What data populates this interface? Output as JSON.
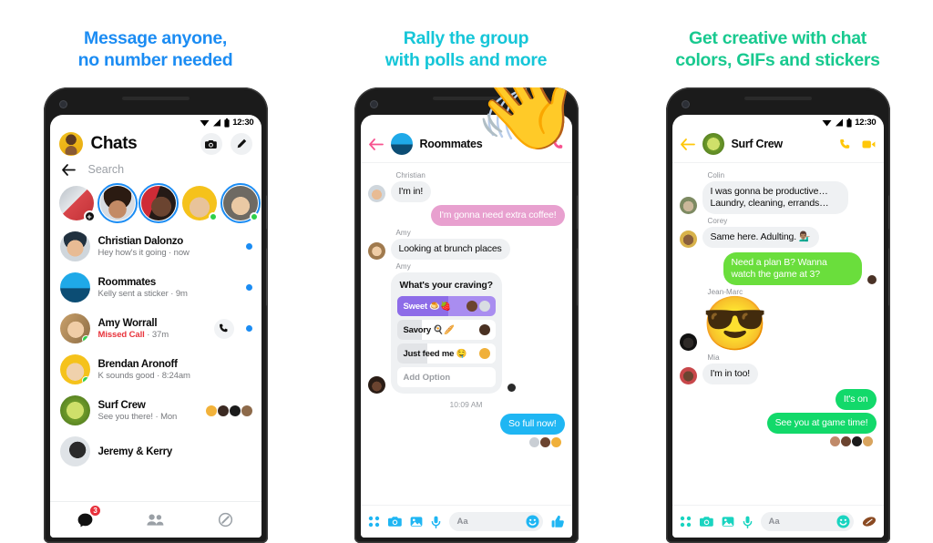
{
  "panels": [
    {
      "headline_line1": "Message anyone,",
      "headline_line2": "no number needed",
      "headline_color": "#1b8cf3"
    },
    {
      "headline_line1": "Rally the group",
      "headline_line2": "with polls and more",
      "headline_color": "#16c6d8"
    },
    {
      "headline_line1": "Get creative with chat",
      "headline_line2": "colors, GIFs and stickers",
      "headline_color": "#18c98f"
    }
  ],
  "status_bar": {
    "time": "12:30",
    "wifi_icon": "wifi-icon",
    "signal_icon": "signal-icon",
    "battery_icon": "battery-icon"
  },
  "phone1": {
    "title": "Chats",
    "my_avatar": "my-avatar",
    "camera_button": "camera-icon",
    "compose_button": "compose-pencil-icon",
    "back_icon": "back-arrow-icon",
    "search_placeholder": "Search",
    "stories": [
      {
        "name": "your-story",
        "badge": "plus",
        "ring": false,
        "online": false
      },
      {
        "name": "story-1",
        "badge": "none",
        "ring": true,
        "online": false
      },
      {
        "name": "story-2",
        "badge": "none",
        "ring": true,
        "online": false
      },
      {
        "name": "story-3",
        "badge": "none",
        "ring": false,
        "online": true
      },
      {
        "name": "story-4",
        "badge": "none",
        "ring": true,
        "online": true
      },
      {
        "name": "story-5",
        "badge": "none",
        "ring": false,
        "online": false
      }
    ],
    "chats": [
      {
        "name": "Christian Dalonzo",
        "preview": "Hey how's it going",
        "time": "now",
        "unread": true,
        "missed": false,
        "online": false
      },
      {
        "name": "Roommates",
        "preview": "Kelly sent a sticker",
        "time": "9m",
        "unread": true,
        "missed": false,
        "online": false
      },
      {
        "name": "Amy Worrall",
        "preview": "Missed Call",
        "time": "37m",
        "unread": true,
        "missed": true,
        "online": true,
        "call_button": "phone-call-icon"
      },
      {
        "name": "Brendan Aronoff",
        "preview": "K sounds good",
        "time": "8:24am",
        "unread": false,
        "missed": false,
        "online": true
      },
      {
        "name": "Surf Crew",
        "preview": "See you there!",
        "time": "Mon",
        "unread": false,
        "missed": false,
        "online": false,
        "seen_by": true
      },
      {
        "name": "Jeremy & Kerry",
        "preview": "",
        "time": "",
        "unread": false,
        "missed": false,
        "online": false
      }
    ],
    "tabs": [
      {
        "name": "tab-chats",
        "icon": "chat-bubble-icon",
        "badge": "3"
      },
      {
        "name": "tab-people",
        "icon": "people-icon",
        "badge": ""
      },
      {
        "name": "tab-discover",
        "icon": "discover-compass-icon",
        "badge": ""
      }
    ]
  },
  "phone2": {
    "accent": "#f7528f",
    "bubble_out": "#e8a0cf",
    "thread_title": "Roommates",
    "back_icon": "back-arrow-icon",
    "call_icon": "phone-call-icon",
    "messages": [
      {
        "sender": "Christian",
        "text": "I'm in!",
        "out": false
      },
      {
        "sender": "",
        "text": "I'm gonna need extra coffee!",
        "out": true
      },
      {
        "sender": "Amy",
        "text": "Looking at brunch places",
        "out": false
      }
    ],
    "poll": {
      "sender": "Amy",
      "question": "What's your craving?",
      "options": [
        {
          "label": "Sweet 🍮🍓",
          "selected": true,
          "fill_pct": 52,
          "voters": 2
        },
        {
          "label": "Savory 🍳🥖",
          "selected": false,
          "fill_pct": 25,
          "voters": 1
        },
        {
          "label": "Just feed me 🤤",
          "selected": false,
          "fill_pct": 25,
          "voters": 1
        }
      ],
      "add_option_label": "Add Option"
    },
    "timestamp": "10:09 AM",
    "last_message": {
      "text": "So full now!",
      "out": true,
      "color": "#1fb6f3"
    },
    "reactions_count": 3,
    "composer": {
      "apps_icon": "apps-grid-icon",
      "camera_icon": "camera-icon",
      "gallery_icon": "gallery-icon",
      "mic_icon": "microphone-icon",
      "placeholder": "Aa",
      "emoji_icon": "smiley-icon",
      "like_icon": "thumbs-up-icon"
    },
    "hand_sticker": "waving-hand-emoji"
  },
  "phone3": {
    "accent": "#ffc709",
    "bubble_out": "#00d94a",
    "thread_title": "Surf Crew",
    "back_icon": "back-arrow-icon",
    "call_icon": "phone-call-icon",
    "video_icon": "video-camera-icon",
    "messages": [
      {
        "sender": "Colin",
        "text": "I was gonna be productive… Laundry, cleaning, errands…",
        "out": false
      },
      {
        "sender": "Corey",
        "text": "Same here. Adulting. 💁🏽‍♂️",
        "out": false
      },
      {
        "sender": "",
        "text": "Need a plan B? Wanna watch the game at 3?",
        "out": true,
        "reacted": true
      },
      {
        "sender": "Jean-Marc",
        "sticker": "😎",
        "out": false
      },
      {
        "sender": "Mia",
        "text": "I'm in too!",
        "out": false
      },
      {
        "sender": "",
        "text": "It's on",
        "out": true
      },
      {
        "sender": "",
        "text": "See you at game time!",
        "out": true
      }
    ],
    "reactions_count": 4,
    "composer": {
      "apps_icon": "apps-grid-icon",
      "camera_icon": "camera-icon",
      "gallery_icon": "gallery-icon",
      "mic_icon": "microphone-icon",
      "placeholder": "Aa",
      "emoji_icon": "smiley-icon",
      "like_icon": "football-sticker-icon"
    }
  }
}
